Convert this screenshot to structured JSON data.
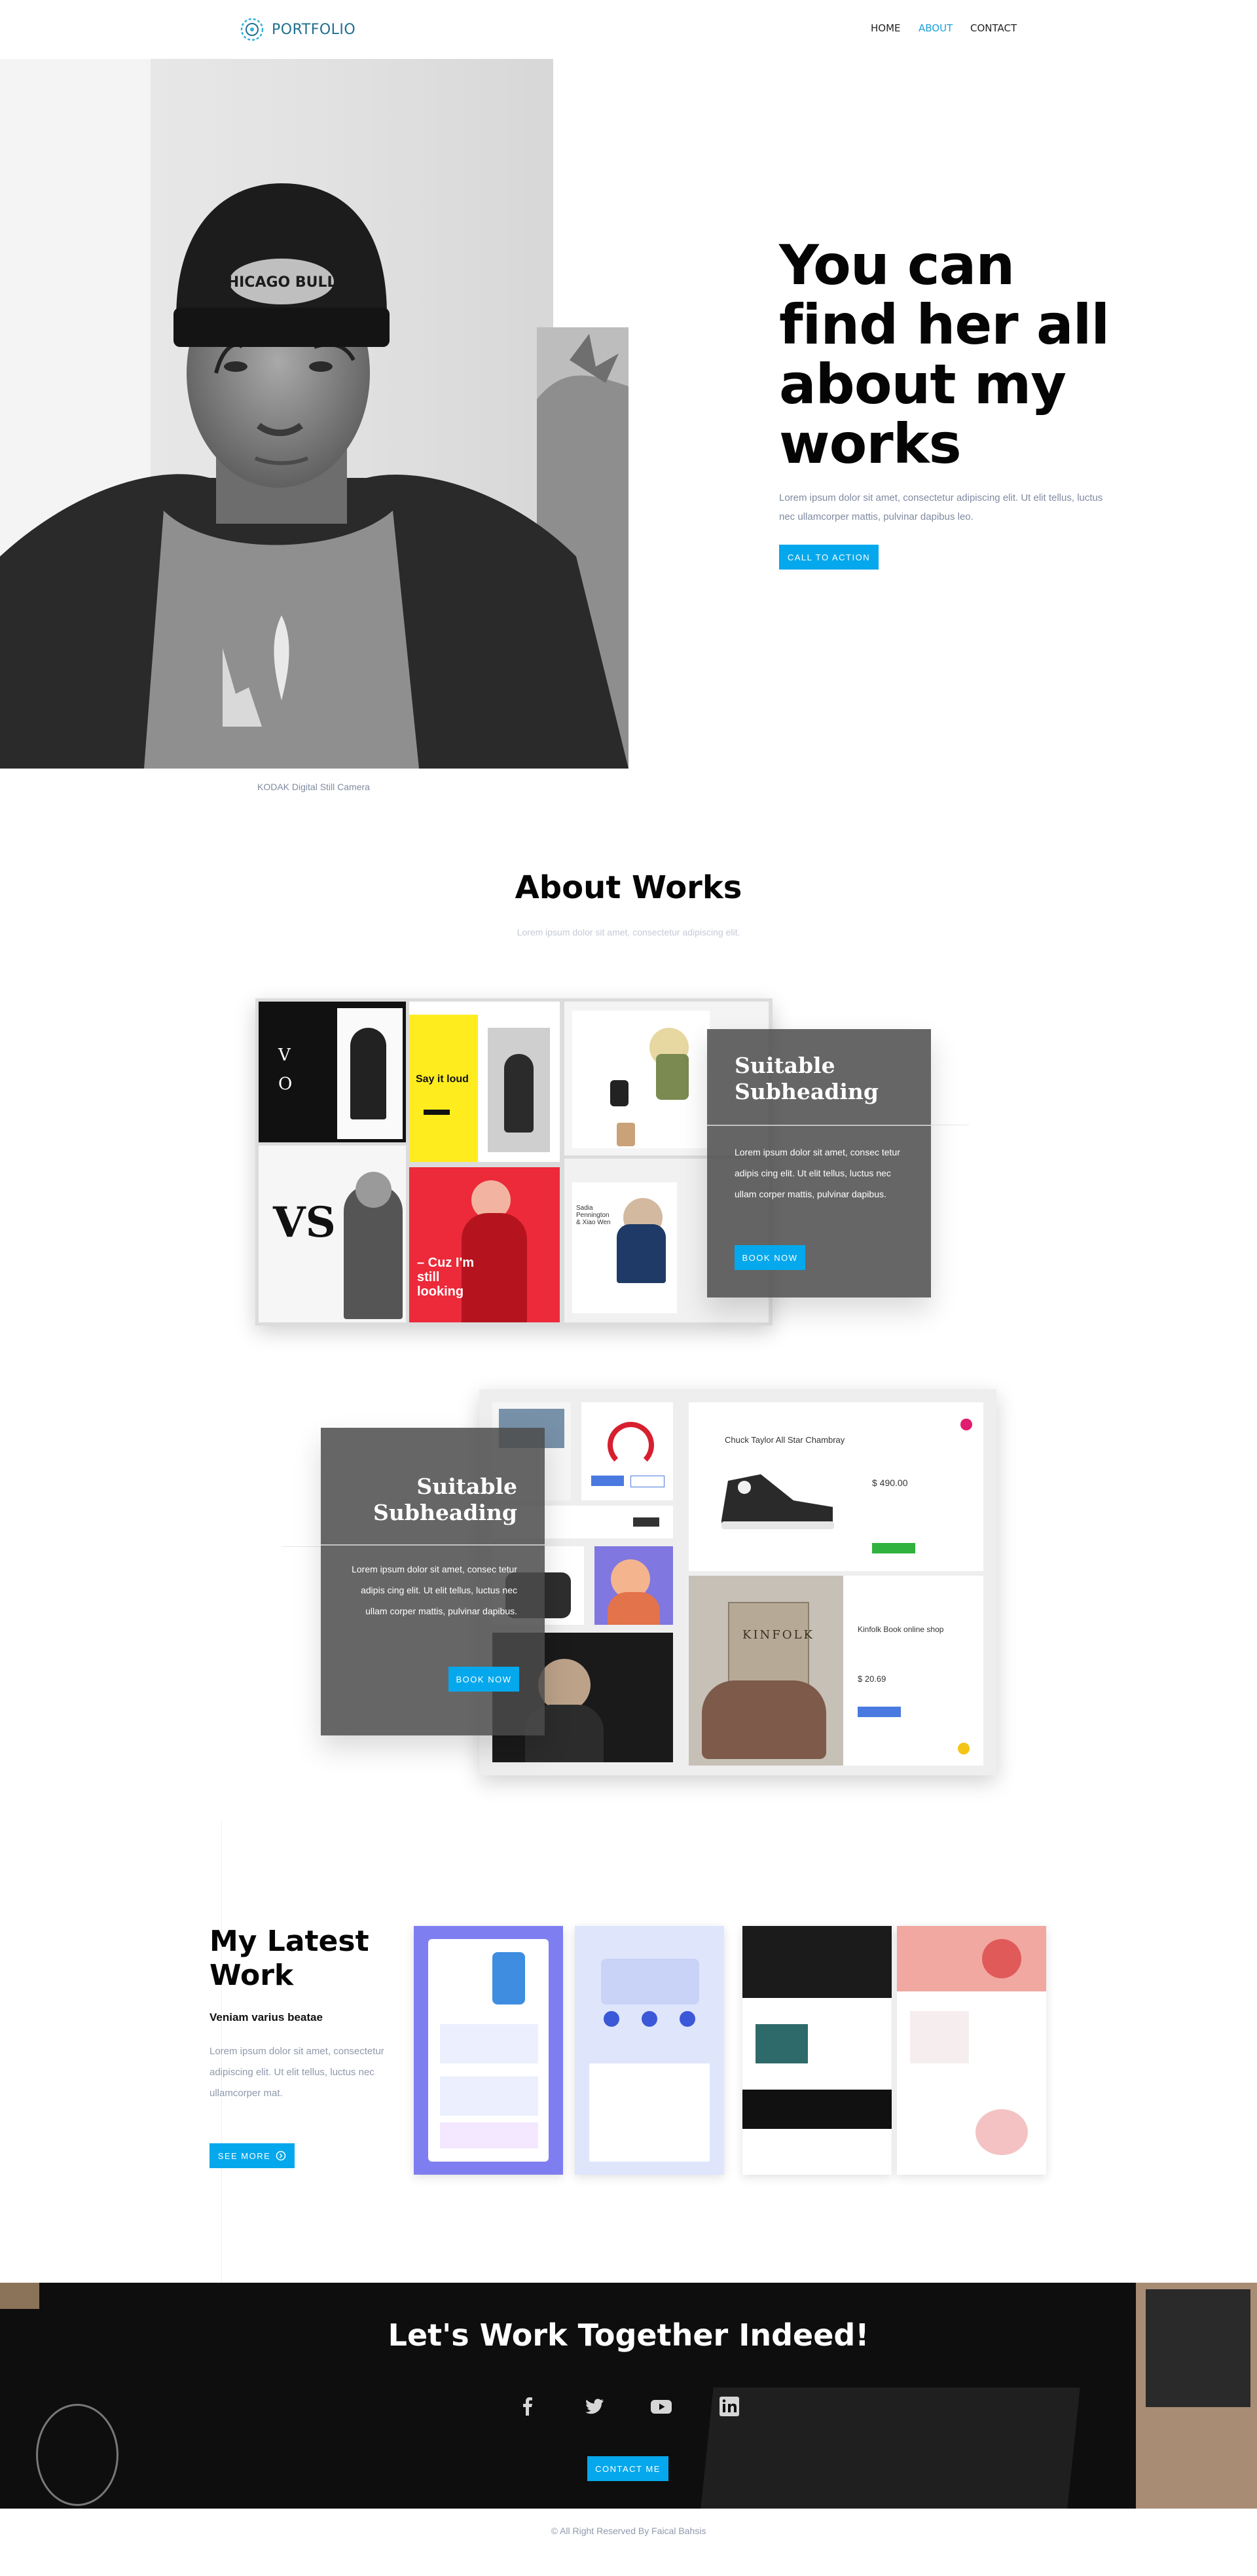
{
  "header": {
    "logo_text": "PORTFOLIO",
    "nav": [
      {
        "label": "HOME",
        "active": false
      },
      {
        "label": "ABOUT",
        "active": true
      },
      {
        "label": "CONTACT",
        "active": false
      }
    ]
  },
  "hero": {
    "title": "You can find her all about my works",
    "text": "Lorem ipsum dolor sit amet, consectetur adipiscing elit. Ut elit tellus, luctus nec ullamcorper mattis, pulvinar dapibus leo.",
    "cta_label": "CALL TO ACTION",
    "photo_caption": "KODAK Digital Still Camera",
    "cap_text": "CHICAGO BULLS"
  },
  "about": {
    "title": "About Works",
    "subtitle": "Lorem ipsum dolor sit amet, consectetur adipiscing elit.",
    "cards": [
      {
        "heading": "Suitable Subheading",
        "text": "Lorem ipsum dolor sit amet, consec tetur adipis cing elit. Ut elit tellus, luctus nec ullam corper mattis, pulvinar dapibus.",
        "button": "BOOK NOW"
      },
      {
        "heading": "Suitable Subheading",
        "text": "Lorem ipsum dolor sit amet, consec tetur adipis cing elit. Ut elit tellus, luctus nec ullam corper mattis, pulvinar dapibus.",
        "button": "BOOK NOW"
      }
    ],
    "mockups_1": {
      "say_it_loud": "Say it loud",
      "cuz": "– Cuz I'm still looking",
      "vs": "VS",
      "fashion_name": "Sadia Pennington & Xiao Wen"
    },
    "mockups_2": {
      "product": "Chuck Taylor All Star Chambray",
      "price": "$ 490.00",
      "kinfolk": "KINFOLK",
      "book": "Kinfolk Book online shop",
      "book_price": "$ 20.69"
    }
  },
  "latest": {
    "title": "My Latest Work",
    "subtitle": "Veniam varius beatae",
    "text": "Lorem ipsum dolor sit amet, consectetur adipiscing elit. Ut elit tellus, luctus nec ullamcorper mat.",
    "button": "SEE MORE"
  },
  "footer": {
    "cta_title": "Let's Work Together Indeed!",
    "button": "CONTACT ME",
    "copyright": "© All Right Reserved By Faical Bahsis",
    "social_icons": [
      "facebook-icon",
      "twitter-icon",
      "youtube-icon",
      "linkedin-icon"
    ]
  },
  "colors": {
    "accent": "#05a8ec",
    "nav_active": "#1aa0d8",
    "card_overlay": "#4b4b4b",
    "footer_bg": "#0e0e0e"
  }
}
